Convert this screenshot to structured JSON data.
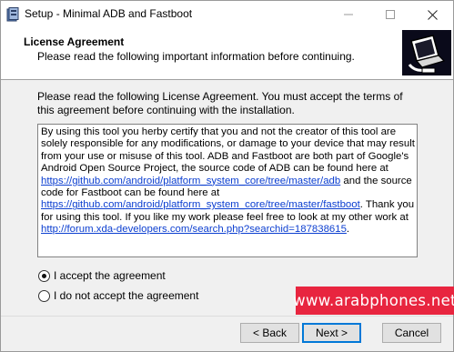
{
  "window": {
    "title": "Setup - Minimal ADB and Fastboot"
  },
  "header": {
    "title": "License Agreement",
    "subtitle": "Please read the following important information before continuing."
  },
  "intro": "Please read the following License Agreement. You must accept the terms of this agreement before continuing with the installation.",
  "license": {
    "p1": "By using this tool you herby certify that you and not the creator of this tool are solely responsible for any modifications, or damage to your device that may result from your use or misuse of this tool.  ADB and Fastboot are both part of Google's Android Open Source Project, the source code of ADB can be found here at ",
    "link1": "https://github.com/android/platform_system_core/tree/master/adb",
    "p2": "  and the source code for Fastboot can be found here at ",
    "link2": "https://github.com/android/platform_system_core/tree/master/fastboot",
    "p3": ".  Thank you for using this tool.  If you like my work please feel free to look at my other work at ",
    "link3": "http://forum.xda-developers.com/search.php?searchid=187838615",
    "p4": "."
  },
  "options": {
    "accept": "I accept the agreement",
    "decline": "I do not accept the agreement",
    "selected": "accept"
  },
  "watermark": "www.arabphones.net",
  "buttons": {
    "back": "< Back",
    "next": "Next >",
    "cancel": "Cancel"
  }
}
